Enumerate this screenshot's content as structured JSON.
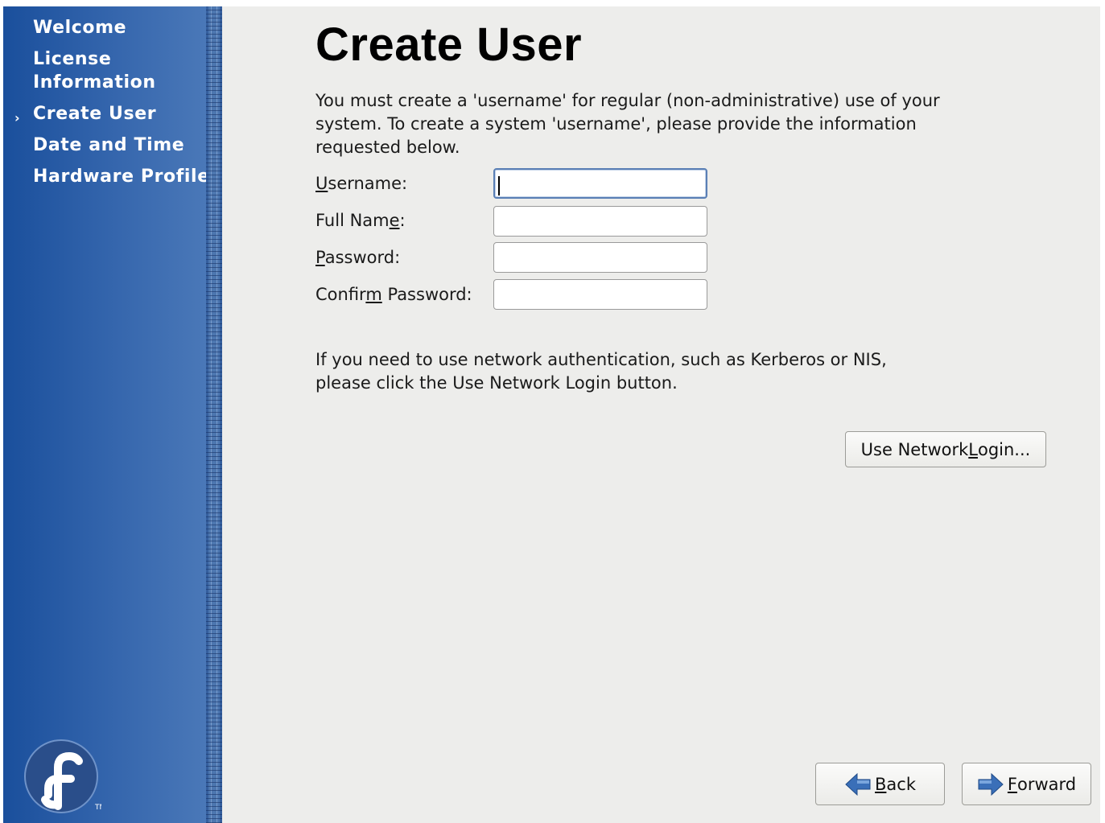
{
  "sidebar": {
    "items": [
      {
        "label": "Welcome",
        "current": false
      },
      {
        "label": "License Information",
        "current": false
      },
      {
        "label": "Create User",
        "current": true
      },
      {
        "label": "Date and Time",
        "current": false
      },
      {
        "label": "Hardware Profile",
        "current": false
      }
    ],
    "current_indicator": "›",
    "logo": {
      "icon": "fedora-logo-icon",
      "mark": "TM"
    },
    "colors": {
      "sidebar": "#2c5ea8",
      "text": "#ffffff"
    }
  },
  "main": {
    "title": "Create User",
    "intro": "You must create a 'username' for regular (non-administrative) use of your\nsystem.  To create a system 'username', please provide the information\nrequested below.",
    "fields": {
      "username": {
        "pre": "",
        "mn": "U",
        "post": "sername:",
        "value": ""
      },
      "fullname": {
        "pre": "Full Nam",
        "mn": "e",
        "post": ":",
        "value": ""
      },
      "password": {
        "pre": "",
        "mn": "P",
        "post": "assword:",
        "value": ""
      },
      "confirm": {
        "pre": "Confir",
        "mn": "m",
        "post": " Password:",
        "value": ""
      }
    },
    "network_note": "If you need to use network authentication, such as Kerberos or NIS,\nplease click the Use Network Login button.",
    "network_button": {
      "pre": "Use Network ",
      "mn": "L",
      "post": "ogin..."
    }
  },
  "footer": {
    "back": {
      "mn": "B",
      "post": "ack",
      "icon": "back-arrow-icon"
    },
    "forward": {
      "mn": "F",
      "post": "orward",
      "icon": "forward-arrow-icon"
    },
    "arrow_color": "#3a6fb8"
  }
}
